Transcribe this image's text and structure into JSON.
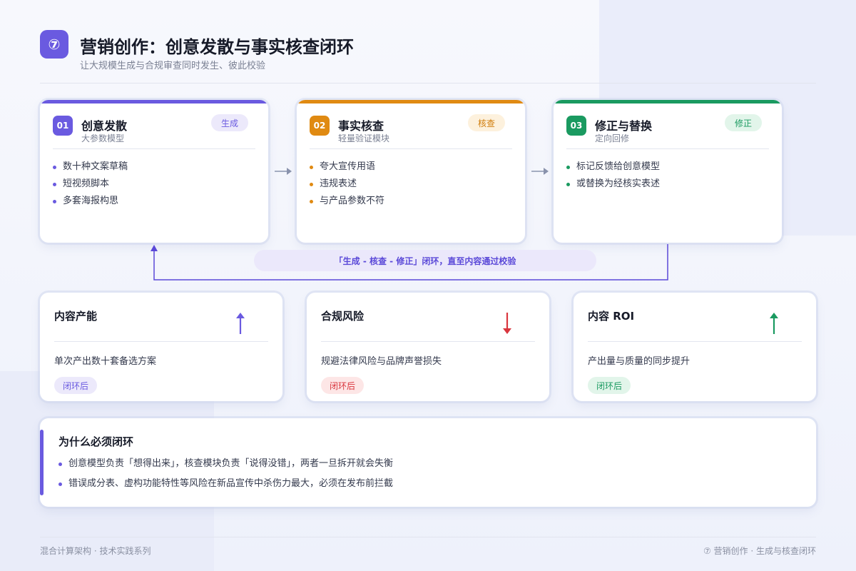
{
  "header": {
    "badge": "⑦",
    "title": "营销创作：创意发散与事实核查闭环",
    "subtitle": "让大规模生成与合规审查同时发生、彼此校验"
  },
  "steps": [
    {
      "num": "01",
      "title": "创意发散",
      "subtitle": "大参数模型",
      "tag": "生成",
      "color": "#6a5ae0",
      "tag_bg": "#ece9fb",
      "tag_fg": "#6a5ae0",
      "items": [
        "数十种文案草稿",
        "短视频脚本",
        "多套海报构思"
      ]
    },
    {
      "num": "02",
      "title": "事实核查",
      "subtitle": "轻量验证模块",
      "tag": "核查",
      "color": "#e08a12",
      "tag_bg": "#fdf1dd",
      "tag_fg": "#d07d0c",
      "items": [
        "夸大宣传用语",
        "违规表述",
        "与产品参数不符"
      ]
    },
    {
      "num": "03",
      "title": "修正与替换",
      "subtitle": "定向回修",
      "tag": "修正",
      "color": "#1a9a60",
      "tag_bg": "#e2f5ea",
      "tag_fg": "#1a9a60",
      "items": [
        "标记反馈给创意模型",
        "或替换为经核实表述"
      ]
    }
  ],
  "loop": {
    "label": "「生成 - 核查 - 修正」闭环，直至内容通过校验",
    "color": "#5a48d8"
  },
  "metrics": [
    {
      "title": "内容产能",
      "arrow": "up",
      "arrow_color": "#6a5ae0",
      "desc": "单次产出数十套备选方案",
      "tag": "闭环后",
      "tag_bg": "#ece9fb",
      "tag_fg": "#6a5ae0"
    },
    {
      "title": "合规风险",
      "arrow": "down",
      "arrow_color": "#d9363e",
      "desc": "规避法律风险与品牌声誉损失",
      "tag": "闭环后",
      "tag_bg": "#fde6e6",
      "tag_fg": "#d9363e"
    },
    {
      "title": "内容 ROI",
      "arrow": "up",
      "arrow_color": "#1a9a60",
      "desc": "产出量与质量的同步提升",
      "tag": "闭环后",
      "tag_bg": "#e2f5ea",
      "tag_fg": "#1a9a60"
    }
  ],
  "why": {
    "title": "为什么必须闭环",
    "items": [
      "创意模型负责「想得出来」，核查模块负责「说得没错」，两者一旦拆开就会失衡",
      "错误成分表、虚构功能特性等风险在新品宣传中杀伤力最大，必须在发布前拦截"
    ]
  },
  "footer": {
    "left": "混合计算架构 · 技术实践系列",
    "right": "⑦ 营销创作 · 生成与核查闭环"
  }
}
